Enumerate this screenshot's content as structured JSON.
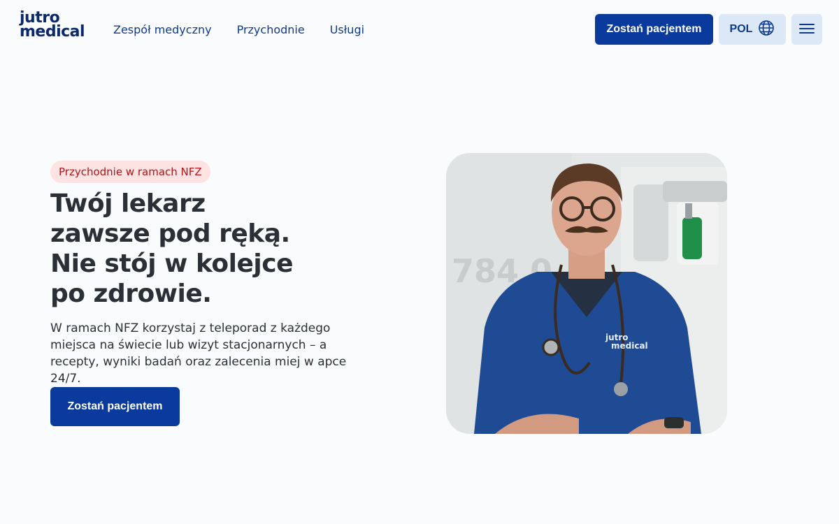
{
  "header": {
    "logo": {
      "line1": "jutro",
      "line2": "medical"
    },
    "nav": [
      {
        "label": "Zespół medyczny"
      },
      {
        "label": "Przychodnie"
      },
      {
        "label": "Usługi"
      }
    ],
    "cta_label": "Zostań pacjentem",
    "language": {
      "label": "POL",
      "icon": "globe-icon"
    },
    "menu_icon": "hamburger-menu-icon"
  },
  "hero": {
    "badge": "Przychodnie w ramach NFZ",
    "title_lines": [
      "Twój lekarz",
      "zawsze pod ręką.",
      "Nie stój w kolejce",
      "po zdrowie."
    ],
    "description": "W ramach NFZ korzystaj z teleporad z każdego miejsca na świecie lub wizyt stacjonarnych – a recepty, wyniki badań oraz zalecenia miej w apce 24/7.",
    "cta_label": "Zostań pacjentem",
    "photo": {
      "wall_text": "784 0",
      "scrubs_logo_line1": "jutro",
      "scrubs_logo_line2": "medical"
    }
  },
  "colors": {
    "primary": "#0a3a9c",
    "nav_text": "#0e3a8c",
    "secondary_bg": "#dde8f7",
    "badge_bg": "#fde3e1",
    "badge_text": "#b3141a",
    "heading": "#2b2f36",
    "page_bg": "#fafbfc"
  }
}
